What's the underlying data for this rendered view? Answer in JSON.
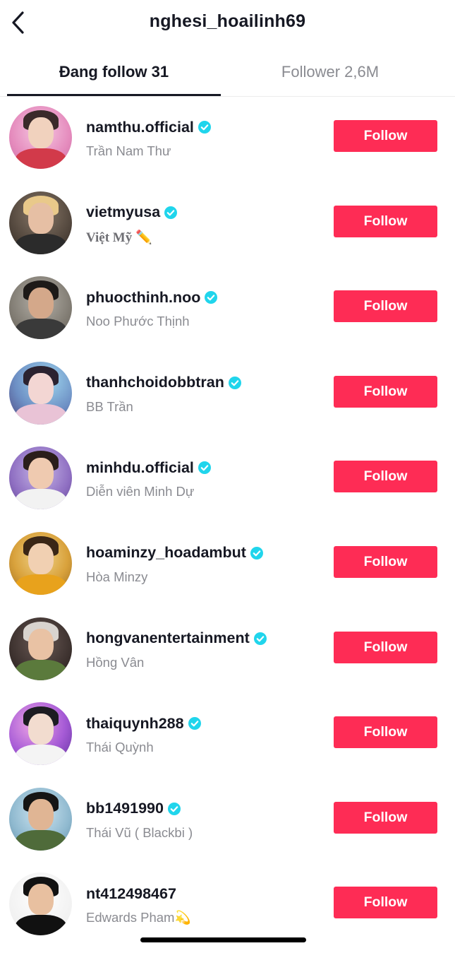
{
  "header": {
    "title": "nghesi_hoailinh69"
  },
  "tabs": {
    "following_label": "Đang follow 31",
    "follower_label": "Follower 2,6M"
  },
  "colors": {
    "accent": "#fe2c55",
    "verified": "#20d5ec",
    "text_primary": "#161823",
    "text_secondary": "#8a8b91"
  },
  "users": [
    {
      "username": "namthu.official",
      "display_name": "Trần Nam Thư",
      "verified": true,
      "button_label": "Follow"
    },
    {
      "username": "vietmyusa",
      "display_name": "Việt Mỹ ✏️",
      "verified": true,
      "button_label": "Follow"
    },
    {
      "username": "phuocthinh.noo",
      "display_name": "Noo Phước Thịnh",
      "verified": true,
      "button_label": "Follow"
    },
    {
      "username": "thanhchoidobbtran",
      "display_name": "BB Trần",
      "verified": true,
      "button_label": "Follow"
    },
    {
      "username": "minhdu.official",
      "display_name": "Diễn viên Minh Dự",
      "verified": true,
      "button_label": "Follow"
    },
    {
      "username": "hoaminzy_hoadambut",
      "display_name": "Hòa Minzy",
      "verified": true,
      "button_label": "Follow"
    },
    {
      "username": "hongvanentertainment",
      "display_name": "Hồng Vân",
      "verified": true,
      "button_label": "Follow"
    },
    {
      "username": "thaiquynh288",
      "display_name": "Thái Quỳnh",
      "verified": true,
      "button_label": "Follow"
    },
    {
      "username": "bb1491990",
      "display_name": "Thái Vũ ( Blackbi )",
      "verified": true,
      "button_label": "Follow"
    },
    {
      "username": "nt412498467",
      "display_name": "Edwards Pham💫",
      "verified": false,
      "button_label": "Follow"
    }
  ]
}
